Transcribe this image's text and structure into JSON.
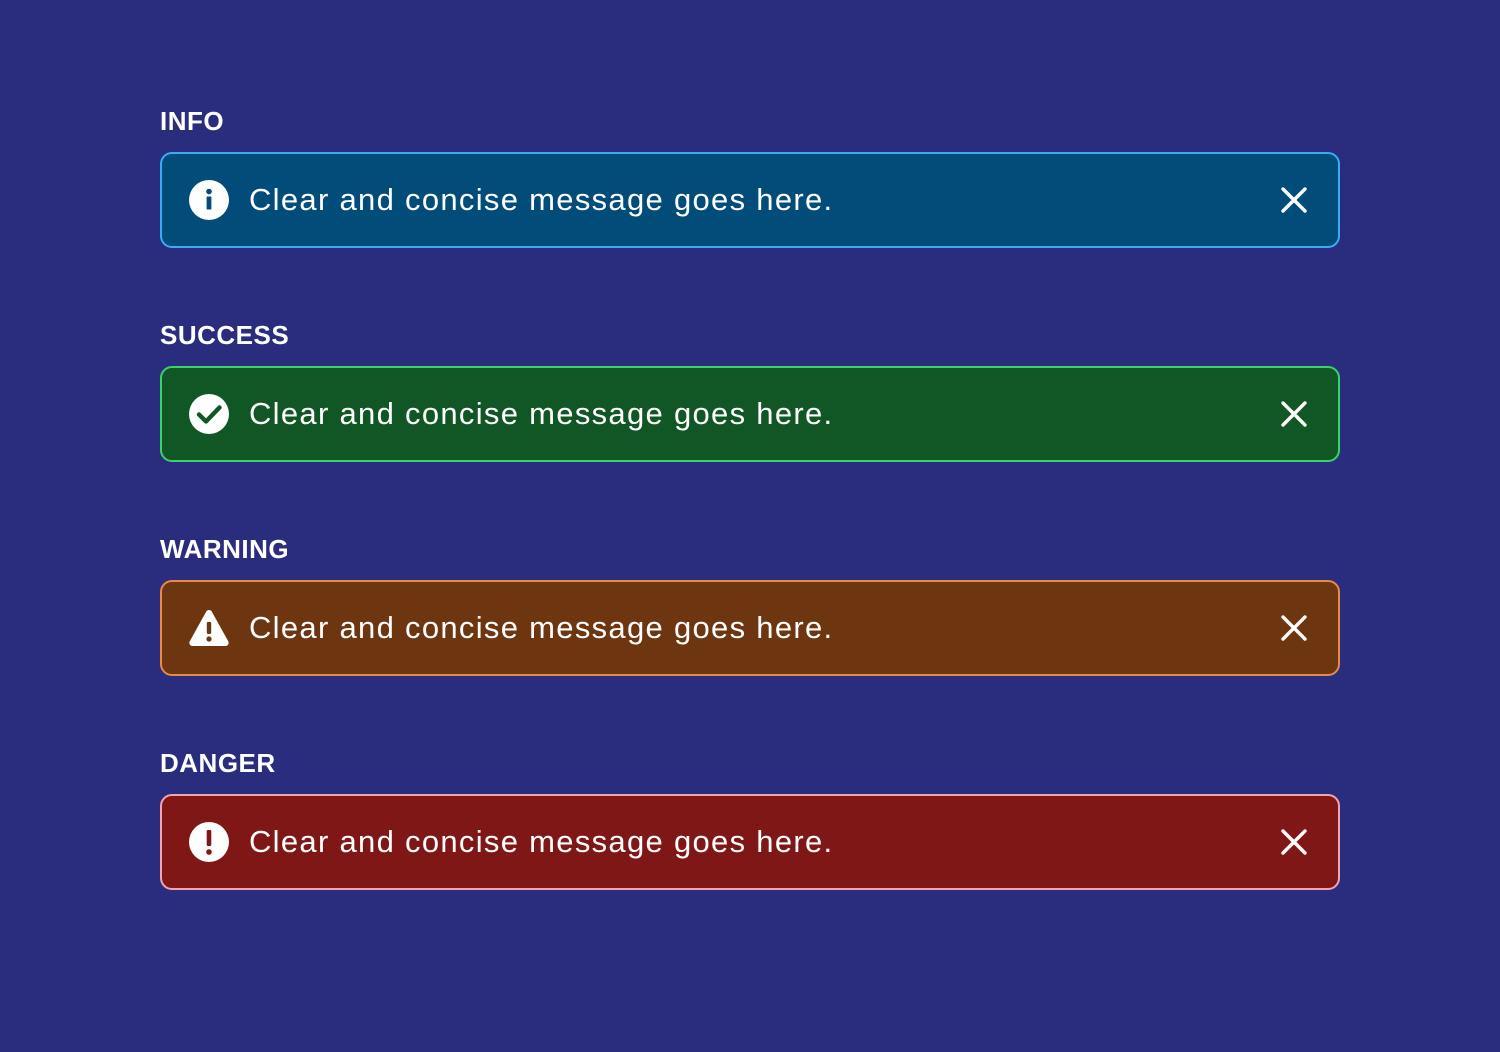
{
  "alerts": [
    {
      "label": "INFO",
      "message": "Clear and concise message goes here.",
      "icon": "info-icon",
      "background": "#024c79",
      "border": "#38aef2"
    },
    {
      "label": "SUCCESS",
      "message": "Clear and concise message goes here.",
      "icon": "check-circle-icon",
      "background": "#115625",
      "border": "#3ad26a"
    },
    {
      "label": "WARNING",
      "message": "Clear and concise message goes here.",
      "icon": "warning-triangle-icon",
      "background": "#6d3510",
      "border": "#e88a48"
    },
    {
      "label": "DANGER",
      "message": "Clear and concise message goes here.",
      "icon": "exclamation-circle-icon",
      "background": "#7f1716",
      "border": "#f2a4b3"
    }
  ],
  "colors": {
    "page_background": "#2a2d7e",
    "text": "#ffffff"
  },
  "close_icon": "close-icon"
}
